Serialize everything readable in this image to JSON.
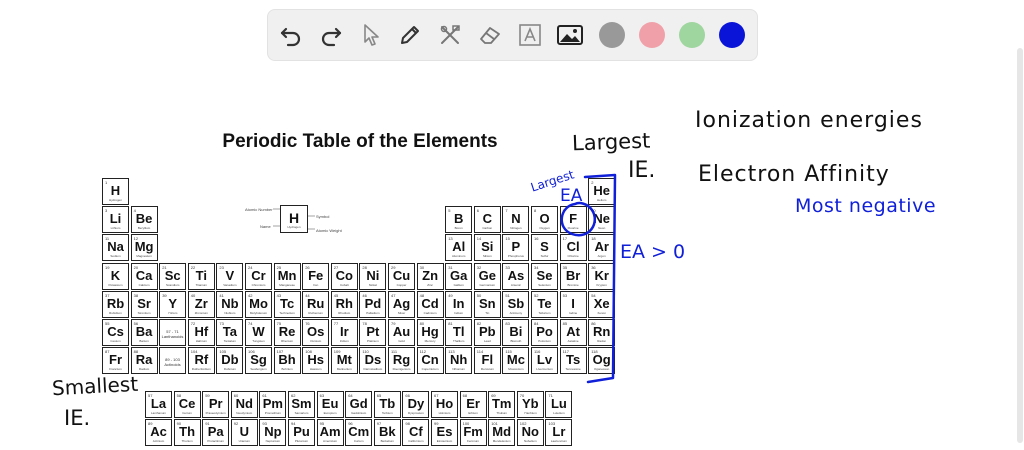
{
  "toolbar": {
    "tools": [
      {
        "name": "undo-icon"
      },
      {
        "name": "redo-icon"
      },
      {
        "name": "select-cursor-icon"
      },
      {
        "name": "pencil-icon"
      },
      {
        "name": "tools-icon"
      },
      {
        "name": "eraser-icon"
      },
      {
        "name": "text-icon"
      },
      {
        "name": "image-icon"
      }
    ],
    "colors": [
      "#999999",
      "#f0a0a8",
      "#9fd59f",
      "#0a14d8"
    ],
    "selected_color": "#0a14d8"
  },
  "table": {
    "title": "Periodic Table of the Elements",
    "legend": {
      "atomic_number": "Atomic Number",
      "name": "Name",
      "symbol_label": "Symbol",
      "weight_label": "Atomic Weight",
      "symbol": "H",
      "element_name": "Hydrogen"
    },
    "placeholder_la": "57 - 71 Lanthanoids",
    "placeholder_ac": "89 - 103 Actinoids",
    "elements": [
      {
        "s": "H",
        "n": 1,
        "r": 1,
        "c": 1,
        "name": "Hydrogen"
      },
      {
        "s": "He",
        "n": 2,
        "r": 1,
        "c": 18,
        "name": "Helium"
      },
      {
        "s": "Li",
        "n": 3,
        "r": 2,
        "c": 1,
        "name": "Lithium"
      },
      {
        "s": "Be",
        "n": 4,
        "r": 2,
        "c": 2,
        "name": "Beryllium"
      },
      {
        "s": "B",
        "n": 5,
        "r": 2,
        "c": 13,
        "name": "Boron"
      },
      {
        "s": "C",
        "n": 6,
        "r": 2,
        "c": 14,
        "name": "Carbon"
      },
      {
        "s": "N",
        "n": 7,
        "r": 2,
        "c": 15,
        "name": "Nitrogen"
      },
      {
        "s": "O",
        "n": 8,
        "r": 2,
        "c": 16,
        "name": "Oxygen"
      },
      {
        "s": "F",
        "n": 9,
        "r": 2,
        "c": 17,
        "name": "Fluorine"
      },
      {
        "s": "Ne",
        "n": 10,
        "r": 2,
        "c": 18,
        "name": "Neon"
      },
      {
        "s": "Na",
        "n": 11,
        "r": 3,
        "c": 1,
        "name": "Sodium"
      },
      {
        "s": "Mg",
        "n": 12,
        "r": 3,
        "c": 2,
        "name": "Magnesium"
      },
      {
        "s": "Al",
        "n": 13,
        "r": 3,
        "c": 13,
        "name": "Aluminum"
      },
      {
        "s": "Si",
        "n": 14,
        "r": 3,
        "c": 14,
        "name": "Silicon"
      },
      {
        "s": "P",
        "n": 15,
        "r": 3,
        "c": 15,
        "name": "Phosphorus"
      },
      {
        "s": "S",
        "n": 16,
        "r": 3,
        "c": 16,
        "name": "Sulfur"
      },
      {
        "s": "Cl",
        "n": 17,
        "r": 3,
        "c": 17,
        "name": "Chlorine"
      },
      {
        "s": "Ar",
        "n": 18,
        "r": 3,
        "c": 18,
        "name": "Argon"
      },
      {
        "s": "K",
        "n": 19,
        "r": 4,
        "c": 1,
        "name": "Potassium"
      },
      {
        "s": "Ca",
        "n": 20,
        "r": 4,
        "c": 2,
        "name": "Calcium"
      },
      {
        "s": "Sc",
        "n": 21,
        "r": 4,
        "c": 3,
        "name": "Scandium"
      },
      {
        "s": "Ti",
        "n": 22,
        "r": 4,
        "c": 4,
        "name": "Titanium"
      },
      {
        "s": "V",
        "n": 23,
        "r": 4,
        "c": 5,
        "name": "Vanadium"
      },
      {
        "s": "Cr",
        "n": 24,
        "r": 4,
        "c": 6,
        "name": "Chromium"
      },
      {
        "s": "Mn",
        "n": 25,
        "r": 4,
        "c": 7,
        "name": "Manganese"
      },
      {
        "s": "Fe",
        "n": 26,
        "r": 4,
        "c": 8,
        "name": "Iron"
      },
      {
        "s": "Co",
        "n": 27,
        "r": 4,
        "c": 9,
        "name": "Cobalt"
      },
      {
        "s": "Ni",
        "n": 28,
        "r": 4,
        "c": 10,
        "name": "Nickel"
      },
      {
        "s": "Cu",
        "n": 29,
        "r": 4,
        "c": 11,
        "name": "Copper"
      },
      {
        "s": "Zn",
        "n": 30,
        "r": 4,
        "c": 12,
        "name": "Zinc"
      },
      {
        "s": "Ga",
        "n": 31,
        "r": 4,
        "c": 13,
        "name": "Gallium"
      },
      {
        "s": "Ge",
        "n": 32,
        "r": 4,
        "c": 14,
        "name": "Germanium"
      },
      {
        "s": "As",
        "n": 33,
        "r": 4,
        "c": 15,
        "name": "Arsenic"
      },
      {
        "s": "Se",
        "n": 34,
        "r": 4,
        "c": 16,
        "name": "Selenium"
      },
      {
        "s": "Br",
        "n": 35,
        "r": 4,
        "c": 17,
        "name": "Bromine"
      },
      {
        "s": "Kr",
        "n": 36,
        "r": 4,
        "c": 18,
        "name": "Krypton"
      },
      {
        "s": "Rb",
        "n": 37,
        "r": 5,
        "c": 1,
        "name": "Rubidium"
      },
      {
        "s": "Sr",
        "n": 38,
        "r": 5,
        "c": 2,
        "name": "Strontium"
      },
      {
        "s": "Y",
        "n": 39,
        "r": 5,
        "c": 3,
        "name": "Yttrium"
      },
      {
        "s": "Zr",
        "n": 40,
        "r": 5,
        "c": 4,
        "name": "Zirconium"
      },
      {
        "s": "Nb",
        "n": 41,
        "r": 5,
        "c": 5,
        "name": "Niobium"
      },
      {
        "s": "Mo",
        "n": 42,
        "r": 5,
        "c": 6,
        "name": "Molybdenum"
      },
      {
        "s": "Tc",
        "n": 43,
        "r": 5,
        "c": 7,
        "name": "Technetium"
      },
      {
        "s": "Ru",
        "n": 44,
        "r": 5,
        "c": 8,
        "name": "Ruthenium"
      },
      {
        "s": "Rh",
        "n": 45,
        "r": 5,
        "c": 9,
        "name": "Rhodium"
      },
      {
        "s": "Pd",
        "n": 46,
        "r": 5,
        "c": 10,
        "name": "Palladium"
      },
      {
        "s": "Ag",
        "n": 47,
        "r": 5,
        "c": 11,
        "name": "Silver"
      },
      {
        "s": "Cd",
        "n": 48,
        "r": 5,
        "c": 12,
        "name": "Cadmium"
      },
      {
        "s": "In",
        "n": 49,
        "r": 5,
        "c": 13,
        "name": "Indium"
      },
      {
        "s": "Sn",
        "n": 50,
        "r": 5,
        "c": 14,
        "name": "Tin"
      },
      {
        "s": "Sb",
        "n": 51,
        "r": 5,
        "c": 15,
        "name": "Antimony"
      },
      {
        "s": "Te",
        "n": 52,
        "r": 5,
        "c": 16,
        "name": "Tellurium"
      },
      {
        "s": "I",
        "n": 53,
        "r": 5,
        "c": 17,
        "name": "Iodine"
      },
      {
        "s": "Xe",
        "n": 54,
        "r": 5,
        "c": 18,
        "name": "Xenon"
      },
      {
        "s": "Cs",
        "n": 55,
        "r": 6,
        "c": 1,
        "name": "Cesium"
      },
      {
        "s": "Ba",
        "n": 56,
        "r": 6,
        "c": 2,
        "name": "Barium"
      },
      {
        "s": "Hf",
        "n": 72,
        "r": 6,
        "c": 4,
        "name": "Hafnium"
      },
      {
        "s": "Ta",
        "n": 73,
        "r": 6,
        "c": 5,
        "name": "Tantalum"
      },
      {
        "s": "W",
        "n": 74,
        "r": 6,
        "c": 6,
        "name": "Tungsten"
      },
      {
        "s": "Re",
        "n": 75,
        "r": 6,
        "c": 7,
        "name": "Rhenium"
      },
      {
        "s": "Os",
        "n": 76,
        "r": 6,
        "c": 8,
        "name": "Osmium"
      },
      {
        "s": "Ir",
        "n": 77,
        "r": 6,
        "c": 9,
        "name": "Iridium"
      },
      {
        "s": "Pt",
        "n": 78,
        "r": 6,
        "c": 10,
        "name": "Platinum"
      },
      {
        "s": "Au",
        "n": 79,
        "r": 6,
        "c": 11,
        "name": "Gold"
      },
      {
        "s": "Hg",
        "n": 80,
        "r": 6,
        "c": 12,
        "name": "Mercury"
      },
      {
        "s": "Tl",
        "n": 81,
        "r": 6,
        "c": 13,
        "name": "Thallium"
      },
      {
        "s": "Pb",
        "n": 82,
        "r": 6,
        "c": 14,
        "name": "Lead"
      },
      {
        "s": "Bi",
        "n": 83,
        "r": 6,
        "c": 15,
        "name": "Bismuth"
      },
      {
        "s": "Po",
        "n": 84,
        "r": 6,
        "c": 16,
        "name": "Polonium"
      },
      {
        "s": "At",
        "n": 85,
        "r": 6,
        "c": 17,
        "name": "Astatine"
      },
      {
        "s": "Rn",
        "n": 86,
        "r": 6,
        "c": 18,
        "name": "Radon"
      },
      {
        "s": "Fr",
        "n": 87,
        "r": 7,
        "c": 1,
        "name": "Francium"
      },
      {
        "s": "Ra",
        "n": 88,
        "r": 7,
        "c": 2,
        "name": "Radium"
      },
      {
        "s": "Rf",
        "n": 104,
        "r": 7,
        "c": 4,
        "name": "Rutherfordium"
      },
      {
        "s": "Db",
        "n": 105,
        "r": 7,
        "c": 5,
        "name": "Dubnium"
      },
      {
        "s": "Sg",
        "n": 106,
        "r": 7,
        "c": 6,
        "name": "Seaborgium"
      },
      {
        "s": "Bh",
        "n": 107,
        "r": 7,
        "c": 7,
        "name": "Bohrium"
      },
      {
        "s": "Hs",
        "n": 108,
        "r": 7,
        "c": 8,
        "name": "Hassium"
      },
      {
        "s": "Mt",
        "n": 109,
        "r": 7,
        "c": 9,
        "name": "Meitnerium"
      },
      {
        "s": "Ds",
        "n": 110,
        "r": 7,
        "c": 10,
        "name": "Darmstadtium"
      },
      {
        "s": "Rg",
        "n": 111,
        "r": 7,
        "c": 11,
        "name": "Roentgenium"
      },
      {
        "s": "Cn",
        "n": 112,
        "r": 7,
        "c": 12,
        "name": "Copernicium"
      },
      {
        "s": "Nh",
        "n": 113,
        "r": 7,
        "c": 13,
        "name": "Nihonium"
      },
      {
        "s": "Fl",
        "n": 114,
        "r": 7,
        "c": 14,
        "name": "Flerovium"
      },
      {
        "s": "Mc",
        "n": 115,
        "r": 7,
        "c": 15,
        "name": "Moscovium"
      },
      {
        "s": "Lv",
        "n": 116,
        "r": 7,
        "c": 16,
        "name": "Livermorium"
      },
      {
        "s": "Ts",
        "n": 117,
        "r": 7,
        "c": 17,
        "name": "Tennessine"
      },
      {
        "s": "Og",
        "n": 118,
        "r": 7,
        "c": 18,
        "name": "Oganesson"
      },
      {
        "s": "La",
        "n": 57,
        "r": 8,
        "c": 4,
        "name": "Lanthanum"
      },
      {
        "s": "Ce",
        "n": 58,
        "r": 8,
        "c": 5,
        "name": "Cerium"
      },
      {
        "s": "Pr",
        "n": 59,
        "r": 8,
        "c": 6,
        "name": "Praseodymium"
      },
      {
        "s": "Nd",
        "n": 60,
        "r": 8,
        "c": 7,
        "name": "Neodymium"
      },
      {
        "s": "Pm",
        "n": 61,
        "r": 8,
        "c": 8,
        "name": "Promethium"
      },
      {
        "s": "Sm",
        "n": 62,
        "r": 8,
        "c": 9,
        "name": "Samarium"
      },
      {
        "s": "Eu",
        "n": 63,
        "r": 8,
        "c": 10,
        "name": "Europium"
      },
      {
        "s": "Gd",
        "n": 64,
        "r": 8,
        "c": 11,
        "name": "Gadolinium"
      },
      {
        "s": "Tb",
        "n": 65,
        "r": 8,
        "c": 12,
        "name": "Terbium"
      },
      {
        "s": "Dy",
        "n": 66,
        "r": 8,
        "c": 13,
        "name": "Dysprosium"
      },
      {
        "s": "Ho",
        "n": 67,
        "r": 8,
        "c": 14,
        "name": "Holmium"
      },
      {
        "s": "Er",
        "n": 68,
        "r": 8,
        "c": 15,
        "name": "Erbium"
      },
      {
        "s": "Tm",
        "n": 69,
        "r": 8,
        "c": 16,
        "name": "Thulium"
      },
      {
        "s": "Yb",
        "n": 70,
        "r": 8,
        "c": 17,
        "name": "Ytterbium"
      },
      {
        "s": "Lu",
        "n": 71,
        "r": 8,
        "c": 18,
        "name": "Lutetium"
      },
      {
        "s": "Ac",
        "n": 89,
        "r": 9,
        "c": 4,
        "name": "Actinium"
      },
      {
        "s": "Th",
        "n": 90,
        "r": 9,
        "c": 5,
        "name": "Thorium"
      },
      {
        "s": "Pa",
        "n": 91,
        "r": 9,
        "c": 6,
        "name": "Protactinium"
      },
      {
        "s": "U",
        "n": 92,
        "r": 9,
        "c": 7,
        "name": "Uranium"
      },
      {
        "s": "Np",
        "n": 93,
        "r": 9,
        "c": 8,
        "name": "Neptunium"
      },
      {
        "s": "Pu",
        "n": 94,
        "r": 9,
        "c": 9,
        "name": "Plutonium"
      },
      {
        "s": "Am",
        "n": 95,
        "r": 9,
        "c": 10,
        "name": "Americium"
      },
      {
        "s": "Cm",
        "n": 96,
        "r": 9,
        "c": 11,
        "name": "Curium"
      },
      {
        "s": "Bk",
        "n": 97,
        "r": 9,
        "c": 12,
        "name": "Berkelium"
      },
      {
        "s": "Cf",
        "n": 98,
        "r": 9,
        "c": 13,
        "name": "Californium"
      },
      {
        "s": "Es",
        "n": 99,
        "r": 9,
        "c": 14,
        "name": "Einsteinium"
      },
      {
        "s": "Fm",
        "n": 100,
        "r": 9,
        "c": 15,
        "name": "Fermium"
      },
      {
        "s": "Md",
        "n": 101,
        "r": 9,
        "c": 16,
        "name": "Mendelevium"
      },
      {
        "s": "No",
        "n": 102,
        "r": 9,
        "c": 17,
        "name": "Nobelium"
      },
      {
        "s": "Lr",
        "n": 103,
        "r": 9,
        "c": 18,
        "name": "Lawrencium"
      }
    ]
  },
  "annotations": {
    "largest": "Largest",
    "ie": "IE.",
    "largest_ea_1": "Largest",
    "largest_ea_2": "EA",
    "smallest": "Smallest",
    "smallest_ie": "IE.",
    "ionization": "Ionization energies",
    "electron_affinity": "Electron Affinity",
    "most_negative": "Most negative",
    "ea_gt_0": "EA > 0"
  }
}
